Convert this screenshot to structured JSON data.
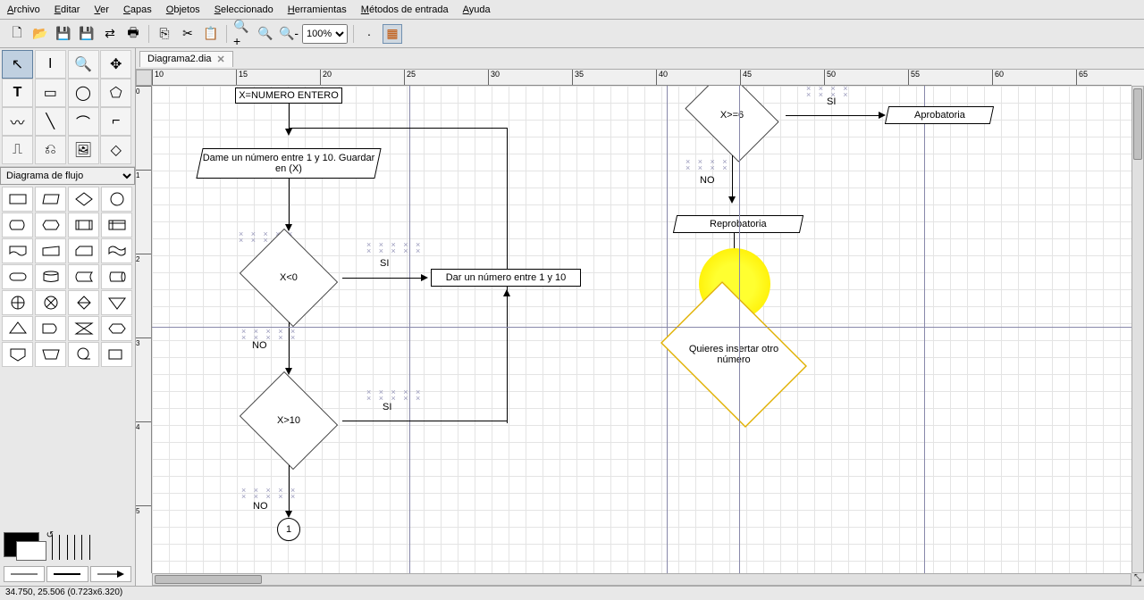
{
  "menu": [
    "Archivo",
    "Editar",
    "Ver",
    "Capas",
    "Objetos",
    "Seleccionado",
    "Herramientas",
    "Métodos de entrada",
    "Ayuda"
  ],
  "zoom": "100%",
  "tab": {
    "name": "Diagrama2.dia"
  },
  "shapeset": "Diagrama de flujo",
  "ruler_h": [
    {
      "p": 0,
      "l": "10"
    },
    {
      "p": 94,
      "l": "15"
    },
    {
      "p": 188,
      "l": "20"
    },
    {
      "p": 282,
      "l": "25"
    },
    {
      "p": 376,
      "l": "30"
    },
    {
      "p": 470,
      "l": "35"
    },
    {
      "p": 564,
      "l": "40"
    },
    {
      "p": 658,
      "l": "45"
    },
    {
      "p": 752,
      "l": "50"
    },
    {
      "p": 846,
      "l": "55"
    },
    {
      "p": 940,
      "l": "60"
    },
    {
      "p": 1034,
      "l": "65"
    }
  ],
  "ruler_v": [
    {
      "p": 0,
      "l": "0"
    },
    {
      "p": 94,
      "l": "1"
    },
    {
      "p": 188,
      "l": "2"
    },
    {
      "p": 282,
      "l": "3"
    },
    {
      "p": 376,
      "l": "4"
    },
    {
      "p": 470,
      "l": "5"
    }
  ],
  "shapes": {
    "s1": "X=NUMERO ENTERO",
    "s2": "Dame un número entre 1 y 10. Guardar en (X)",
    "d1": "X<0",
    "p1": "Dar un número entre 1 y 10",
    "d2": "X>10",
    "c1": "1",
    "d3": "X>=6",
    "p2": "Aprobatoria",
    "p3": "Reprobatoria",
    "d4": "Quieres insertar otro número"
  },
  "labels": {
    "si": "SI",
    "no": "NO"
  },
  "status": "34.750, 25.506 (0.723x6.320)"
}
